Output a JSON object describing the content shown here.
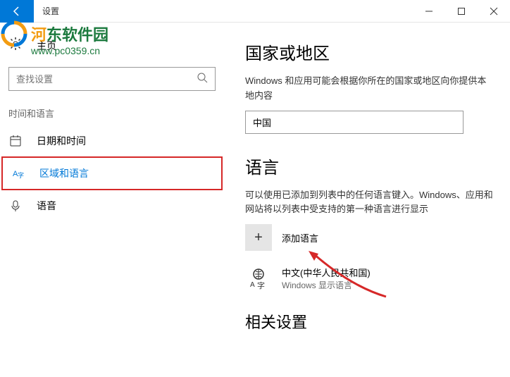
{
  "titlebar": {
    "title": "设置"
  },
  "watermark": {
    "brand_prefix": "河",
    "brand_main": "东软件园",
    "url": "www.pc0359.cn"
  },
  "sidebar": {
    "home": "主页",
    "search_placeholder": "查找设置",
    "category": "时间和语言",
    "items": [
      {
        "label": "日期和时间"
      },
      {
        "label": "区域和语言"
      },
      {
        "label": "语音"
      }
    ]
  },
  "main": {
    "region": {
      "title": "国家或地区",
      "desc": "Windows 和应用可能会根据你所在的国家或地区向你提供本地内容",
      "selected": "中国"
    },
    "language": {
      "title": "语言",
      "desc": "可以使用已添加到列表中的任何语言键入。Windows、应用和网站将以列表中受支持的第一种语言进行显示",
      "add_label": "添加语言",
      "items": [
        {
          "name": "中文(中华人民共和国)",
          "sub": "Windows 显示语言"
        }
      ]
    },
    "related": {
      "title": "相关设置"
    }
  }
}
